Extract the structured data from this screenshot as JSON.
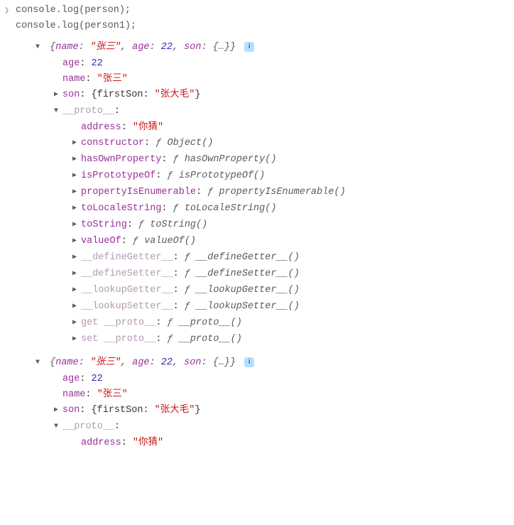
{
  "input": {
    "line1": "console.log(person);",
    "line2": "console.log(person1);"
  },
  "obj1": {
    "summary": {
      "name_k": "name",
      "name_v": "\"张三\"",
      "age_k": "age",
      "age_v": "22",
      "son_k": "son",
      "son_v": "{…}"
    },
    "age_k": "age",
    "age_v": "22",
    "name_k": "name",
    "name_v": "\"张三\"",
    "son_k": "son",
    "son_summary": {
      "firstSon_k": "firstSon",
      "firstSon_v": "\"张大毛\""
    },
    "proto_k": "__proto__",
    "proto": {
      "address_k": "address",
      "address_v": "\"你猜\"",
      "entries": [
        {
          "k": "constructor",
          "v": "Object()"
        },
        {
          "k": "hasOwnProperty",
          "v": "hasOwnProperty()"
        },
        {
          "k": "isPrototypeOf",
          "v": "isPrototypeOf()"
        },
        {
          "k": "propertyIsEnumerable",
          "v": "propertyIsEnumerable()"
        },
        {
          "k": "toLocaleString",
          "v": "toLocaleString()"
        },
        {
          "k": "toString",
          "v": "toString()"
        },
        {
          "k": "valueOf",
          "v": "valueOf()"
        },
        {
          "k": "__defineGetter__",
          "v": "__defineGetter__()"
        },
        {
          "k": "__defineSetter__",
          "v": "__defineSetter__()"
        },
        {
          "k": "__lookupGetter__",
          "v": "__lookupGetter__()"
        },
        {
          "k": "__lookupSetter__",
          "v": "__lookupSetter__()"
        },
        {
          "k": "get __proto__",
          "v": "__proto__()"
        },
        {
          "k": "set __proto__",
          "v": "__proto__()"
        }
      ]
    }
  },
  "obj2": {
    "summary": {
      "name_k": "name",
      "name_v": "\"张三\"",
      "age_k": "age",
      "age_v": "22",
      "son_k": "son",
      "son_v": "{…}"
    },
    "age_k": "age",
    "age_v": "22",
    "name_k": "name",
    "name_v": "\"张三\"",
    "son_k": "son",
    "son_summary": {
      "firstSon_k": "firstSon",
      "firstSon_v": "\"张大毛\""
    },
    "proto_k": "__proto__",
    "proto": {
      "address_k": "address",
      "address_v": "\"你猜\""
    }
  },
  "glyph": {
    "right": "▶",
    "down": "▼",
    "f": "ƒ",
    "info": "i"
  }
}
